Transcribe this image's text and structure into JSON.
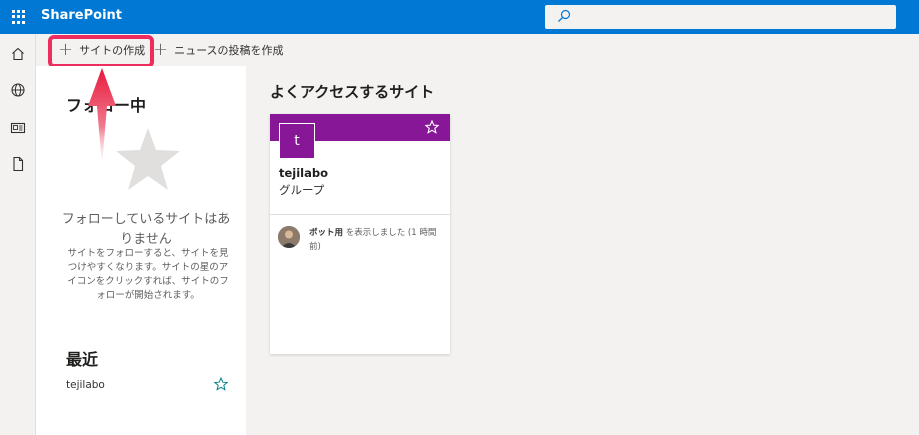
{
  "topbar": {
    "app_name": "SharePoint",
    "waffle_icon": "app-launcher-icon",
    "search_icon": "search-icon",
    "search_placeholder": ""
  },
  "rail": {
    "items": [
      {
        "icon": "home-icon"
      },
      {
        "icon": "globe-icon"
      },
      {
        "icon": "news-icon"
      },
      {
        "icon": "document-icon"
      }
    ]
  },
  "commandbar": {
    "create_site": "サイトの作成",
    "create_news": "ニュースの投稿を作成"
  },
  "following": {
    "heading": "フォロー中",
    "empty_title": "フォローしているサイトはありません",
    "empty_description": "サイトをフォローすると、サイトを見つけやすくなります。サイトの星のアイコンをクリックすれば、サイトのフォローが開始されます。"
  },
  "recent": {
    "heading": "最近",
    "items": [
      {
        "label": "tejilabo"
      }
    ]
  },
  "frequent": {
    "heading": "よくアクセスするサイト",
    "cards": [
      {
        "logo_letter": "t",
        "name": "tejilabo",
        "type": "グループ",
        "activity_actor": "ボット用",
        "activity_text": "を表示しました (1 時間前)"
      }
    ]
  },
  "colors": {
    "suite_bar": "#0078d4",
    "site_accent": "#881798",
    "highlight": "#ee2c5e"
  }
}
